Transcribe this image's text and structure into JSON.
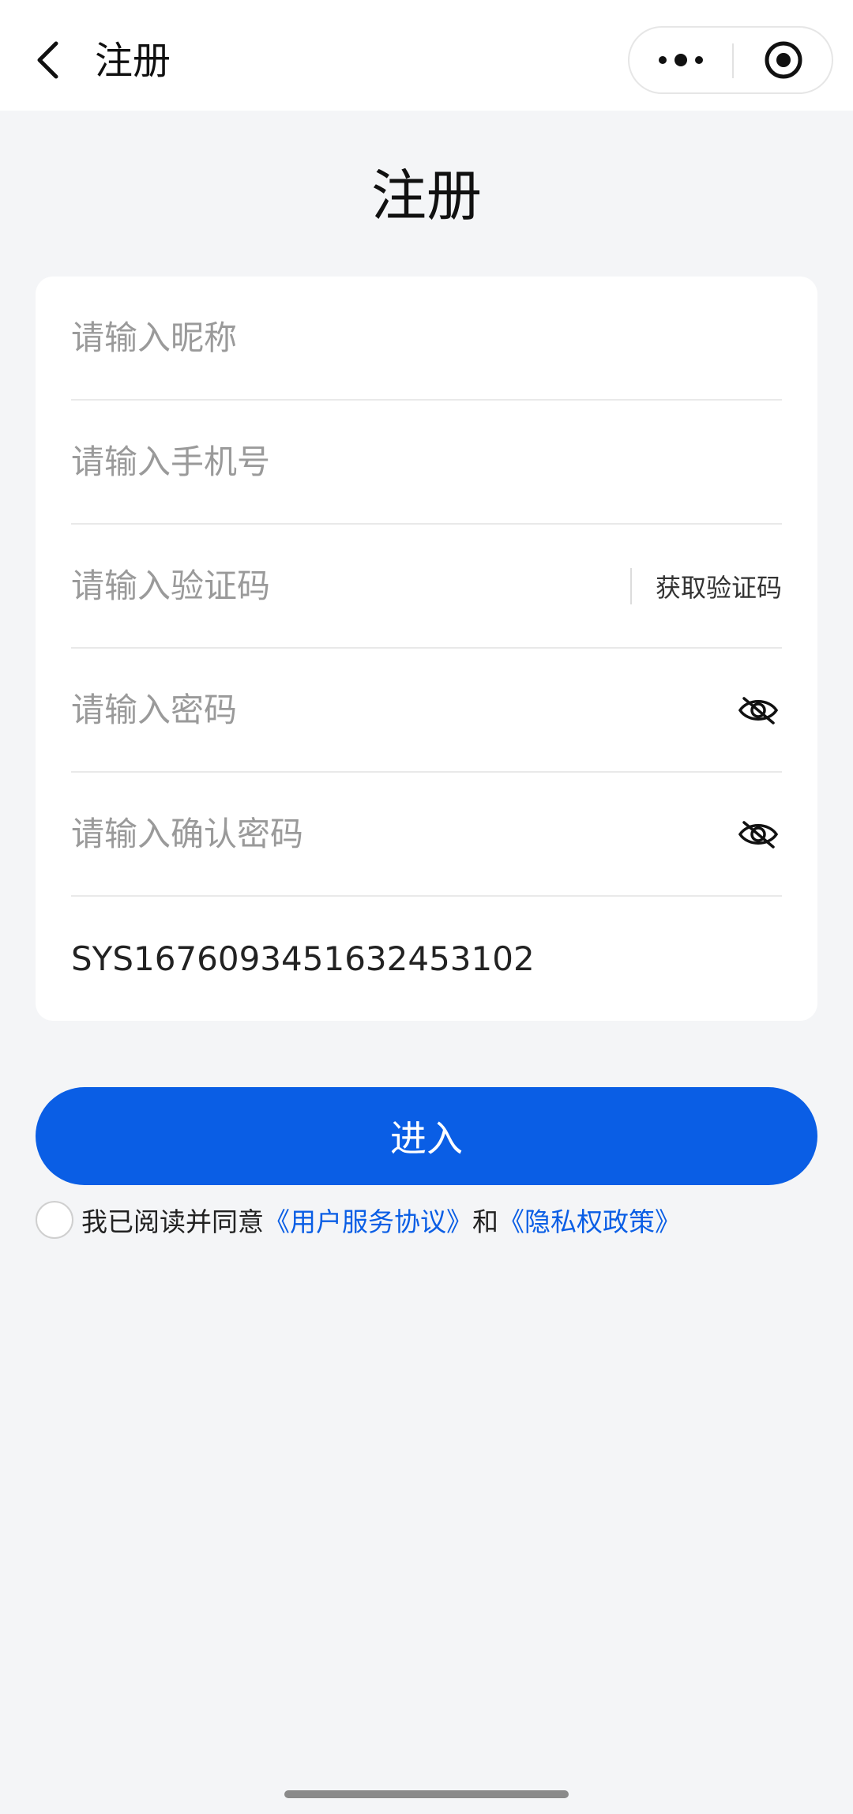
{
  "navbar": {
    "title": "注册",
    "back_icon": "chevron-left-icon",
    "menu_icon": "more-dots-icon",
    "close_icon": "target-close-icon"
  },
  "page": {
    "heading": "注册"
  },
  "form": {
    "nickname_placeholder": "请输入昵称",
    "phone_placeholder": "请输入手机号",
    "code_placeholder": "请输入验证码",
    "get_code_label": "获取验证码",
    "password_placeholder": "请输入密码",
    "confirm_password_placeholder": "请输入确认密码",
    "password_toggle_icon": "eye-off-icon",
    "invite_code_value": "SYS1676093451632453102"
  },
  "submit": {
    "label": "进入"
  },
  "agreement": {
    "prefix": "我已阅读并同意",
    "user_agreement": "《用户服务协议》",
    "and": "和",
    "privacy_policy": "《隐私权政策》",
    "checked": false
  },
  "colors": {
    "primary": "#0a5ee5",
    "background": "#f4f5f7",
    "card": "#ffffff",
    "placeholder": "#9a9a9a"
  }
}
